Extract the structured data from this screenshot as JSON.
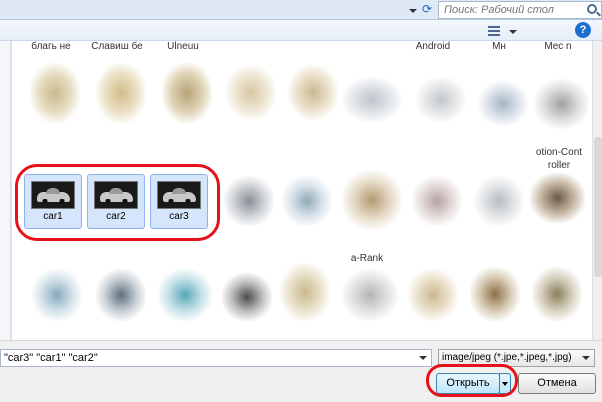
{
  "search": {
    "placeholder": "Поиск: Рабочий стол"
  },
  "toolbar": {
    "view_icon": "view-options-icon",
    "help_icon": "help-icon",
    "help_label": "?"
  },
  "top_row_labels": [
    "благь не",
    "Славиш бе",
    "Ulneuu",
    "Android",
    "Мн",
    "Mec n"
  ],
  "mid_row_labels": {
    "controller_1": "otion-Cont",
    "controller_2": "roller",
    "rank": "a-Rank"
  },
  "selected_files": [
    {
      "name": "car1"
    },
    {
      "name": "car2"
    },
    {
      "name": "car3"
    }
  ],
  "footer": {
    "filename_value": "\"car3\" \"car1\" \"car2\"",
    "filetype_value": "image/jpeg (*.jpe,*.jpeg,*.jpg)",
    "open_label": "Открыть",
    "cancel_label": "Отмена"
  },
  "colors": {
    "highlight": "#e5121a",
    "selection": "#d5e5fb",
    "accent": "#1e6fd1"
  }
}
